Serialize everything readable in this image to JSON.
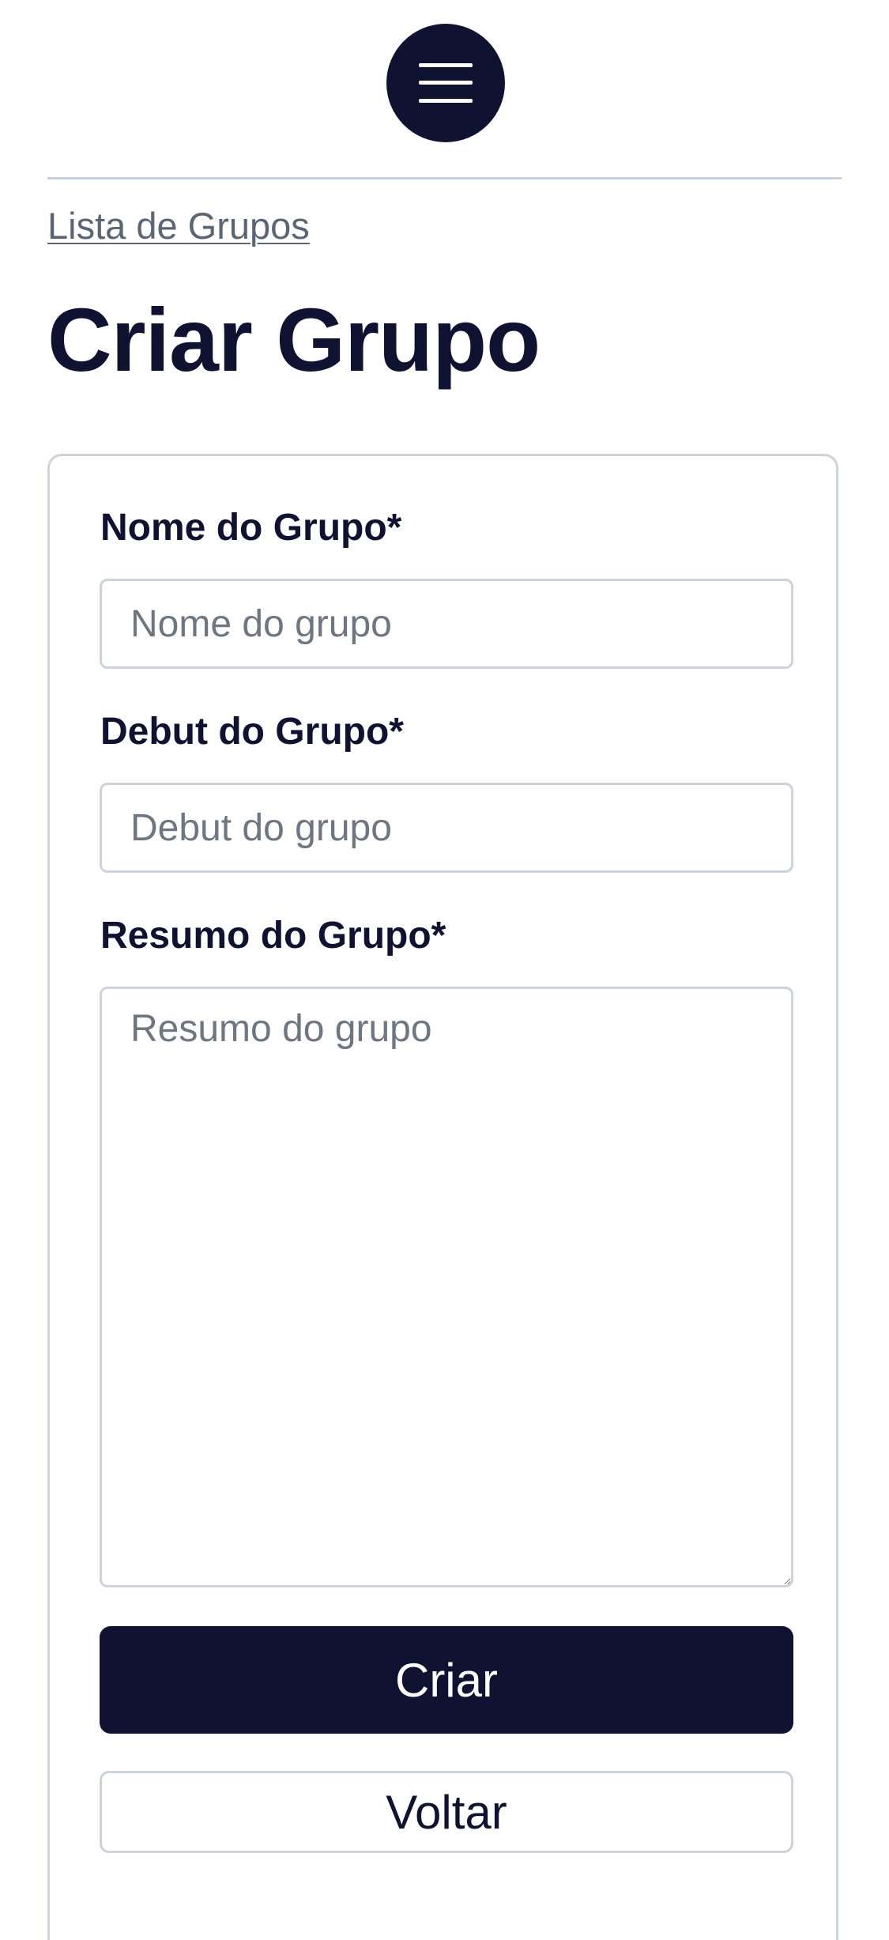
{
  "header": {
    "menu_icon": "hamburger-menu-icon"
  },
  "breadcrumb": {
    "link_label": "Lista de Grupos"
  },
  "page": {
    "title": "Criar Grupo"
  },
  "form": {
    "name_label": "Nome do Grupo*",
    "name_value": "",
    "name_placeholder": "Nome do grupo",
    "debut_label": "Debut do Grupo*",
    "debut_value": "",
    "debut_placeholder": "Debut do grupo",
    "summary_label": "Resumo do Grupo*",
    "summary_value": "",
    "summary_placeholder": "Resumo do grupo",
    "submit_label": "Criar",
    "back_label": "Voltar"
  },
  "colors": {
    "primary": "#0f1230",
    "border": "#cdd3db",
    "link": "#5b6675",
    "placeholder": "#6e7681"
  }
}
